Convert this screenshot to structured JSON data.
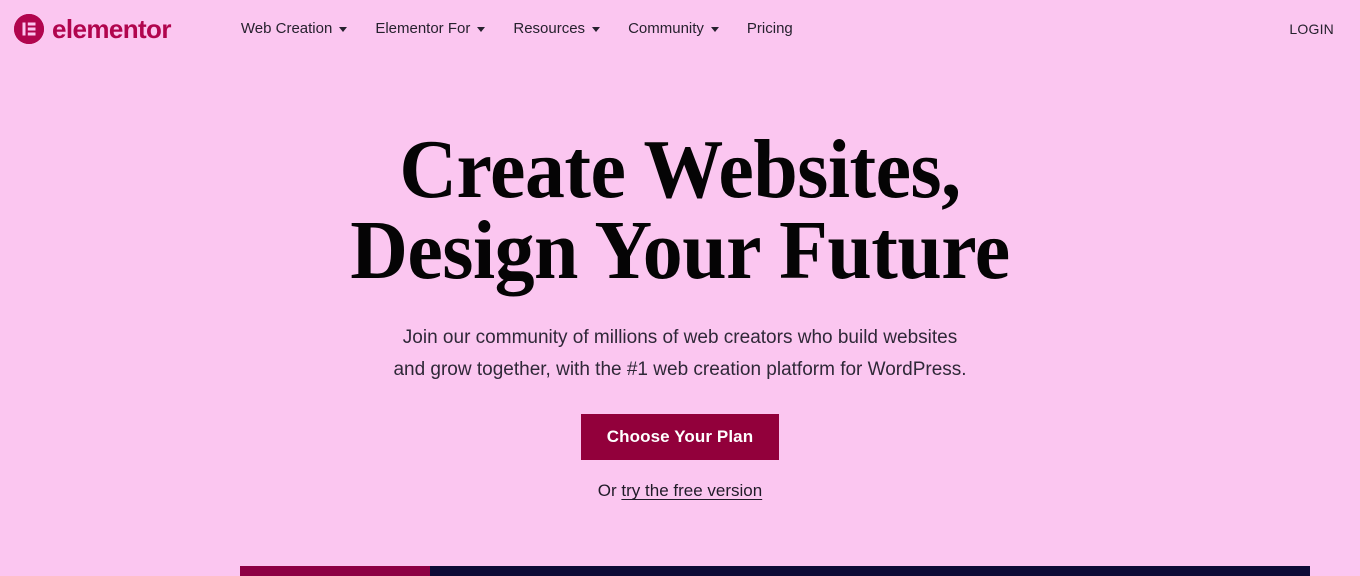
{
  "brand": {
    "name": "elementor",
    "mark_icon": "elementor-logo-icon",
    "color": "#b1054e"
  },
  "header": {
    "nav": [
      {
        "label": "Web Creation",
        "has_dropdown": true,
        "icon": "chevron-down-icon"
      },
      {
        "label": "Elementor For",
        "has_dropdown": true,
        "icon": "chevron-down-icon"
      },
      {
        "label": "Resources",
        "has_dropdown": true,
        "icon": "chevron-down-icon"
      },
      {
        "label": "Community",
        "has_dropdown": true,
        "icon": "chevron-down-icon"
      },
      {
        "label": "Pricing",
        "has_dropdown": false
      }
    ],
    "login_label": "LOGIN"
  },
  "hero": {
    "title_line1": "Create Websites,",
    "title_line2": "Design Your Future",
    "sub_line1": "Join our community of millions of web creators who build websites",
    "sub_line2": "and grow together, with the #1 web creation platform for WordPress.",
    "cta_label": "Choose Your Plan",
    "free_prefix": "Or ",
    "free_link_label": "try the free version"
  },
  "colors": {
    "background": "#fbc6f0",
    "brand": "#b1054e",
    "cta": "#92003b",
    "bar_crimson": "#8d0044",
    "bar_navy": "#0d0b36",
    "text": "#26212e"
  }
}
